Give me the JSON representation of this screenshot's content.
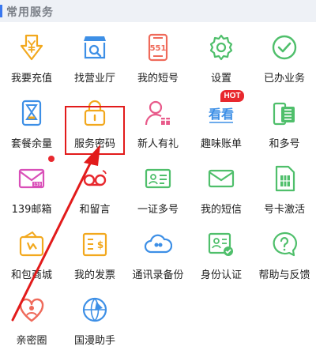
{
  "section": {
    "title": "常用服务"
  },
  "badge": {
    "hot": "HOT"
  },
  "colors": {
    "accent": "#3a78f0",
    "highlight": "#e21b1b",
    "badge": "#e8282e"
  },
  "items": [
    {
      "label": "我要充值",
      "icon": "recharge-yen-icon"
    },
    {
      "label": "找营业厅",
      "icon": "store-search-icon"
    },
    {
      "label": "我的短号",
      "icon": "phone-number-icon"
    },
    {
      "label": "设置",
      "icon": "gear-icon"
    },
    {
      "label": "已办业务",
      "icon": "check-circle-icon"
    },
    {
      "label": "套餐余量",
      "icon": "hourglass-icon"
    },
    {
      "label": "服务密码",
      "icon": "lock-icon"
    },
    {
      "label": "新人有礼",
      "icon": "user-gift-icon"
    },
    {
      "label": "趣味账单",
      "icon": "fun-bill-icon"
    },
    {
      "label": "和多号",
      "icon": "sim-phone-icon"
    },
    {
      "label": "139邮箱",
      "icon": "mail-139-icon"
    },
    {
      "label": "和留言",
      "icon": "voicemail-icon"
    },
    {
      "label": "一证多号",
      "icon": "id-card-icon"
    },
    {
      "label": "我的短信",
      "icon": "envelope-icon"
    },
    {
      "label": "号卡激活",
      "icon": "sim-card-icon"
    },
    {
      "label": "和包商城",
      "icon": "wallet-shop-icon"
    },
    {
      "label": "我的发票",
      "icon": "invoice-icon"
    },
    {
      "label": "通讯录备份",
      "icon": "contacts-cloud-icon"
    },
    {
      "label": "身份认证",
      "icon": "id-verify-icon"
    },
    {
      "label": "帮助与反馈",
      "icon": "help-bubble-icon"
    },
    {
      "label": "亲密圈",
      "icon": "heart-people-icon"
    },
    {
      "label": "国漫助手",
      "icon": "roaming-globe-icon"
    }
  ]
}
